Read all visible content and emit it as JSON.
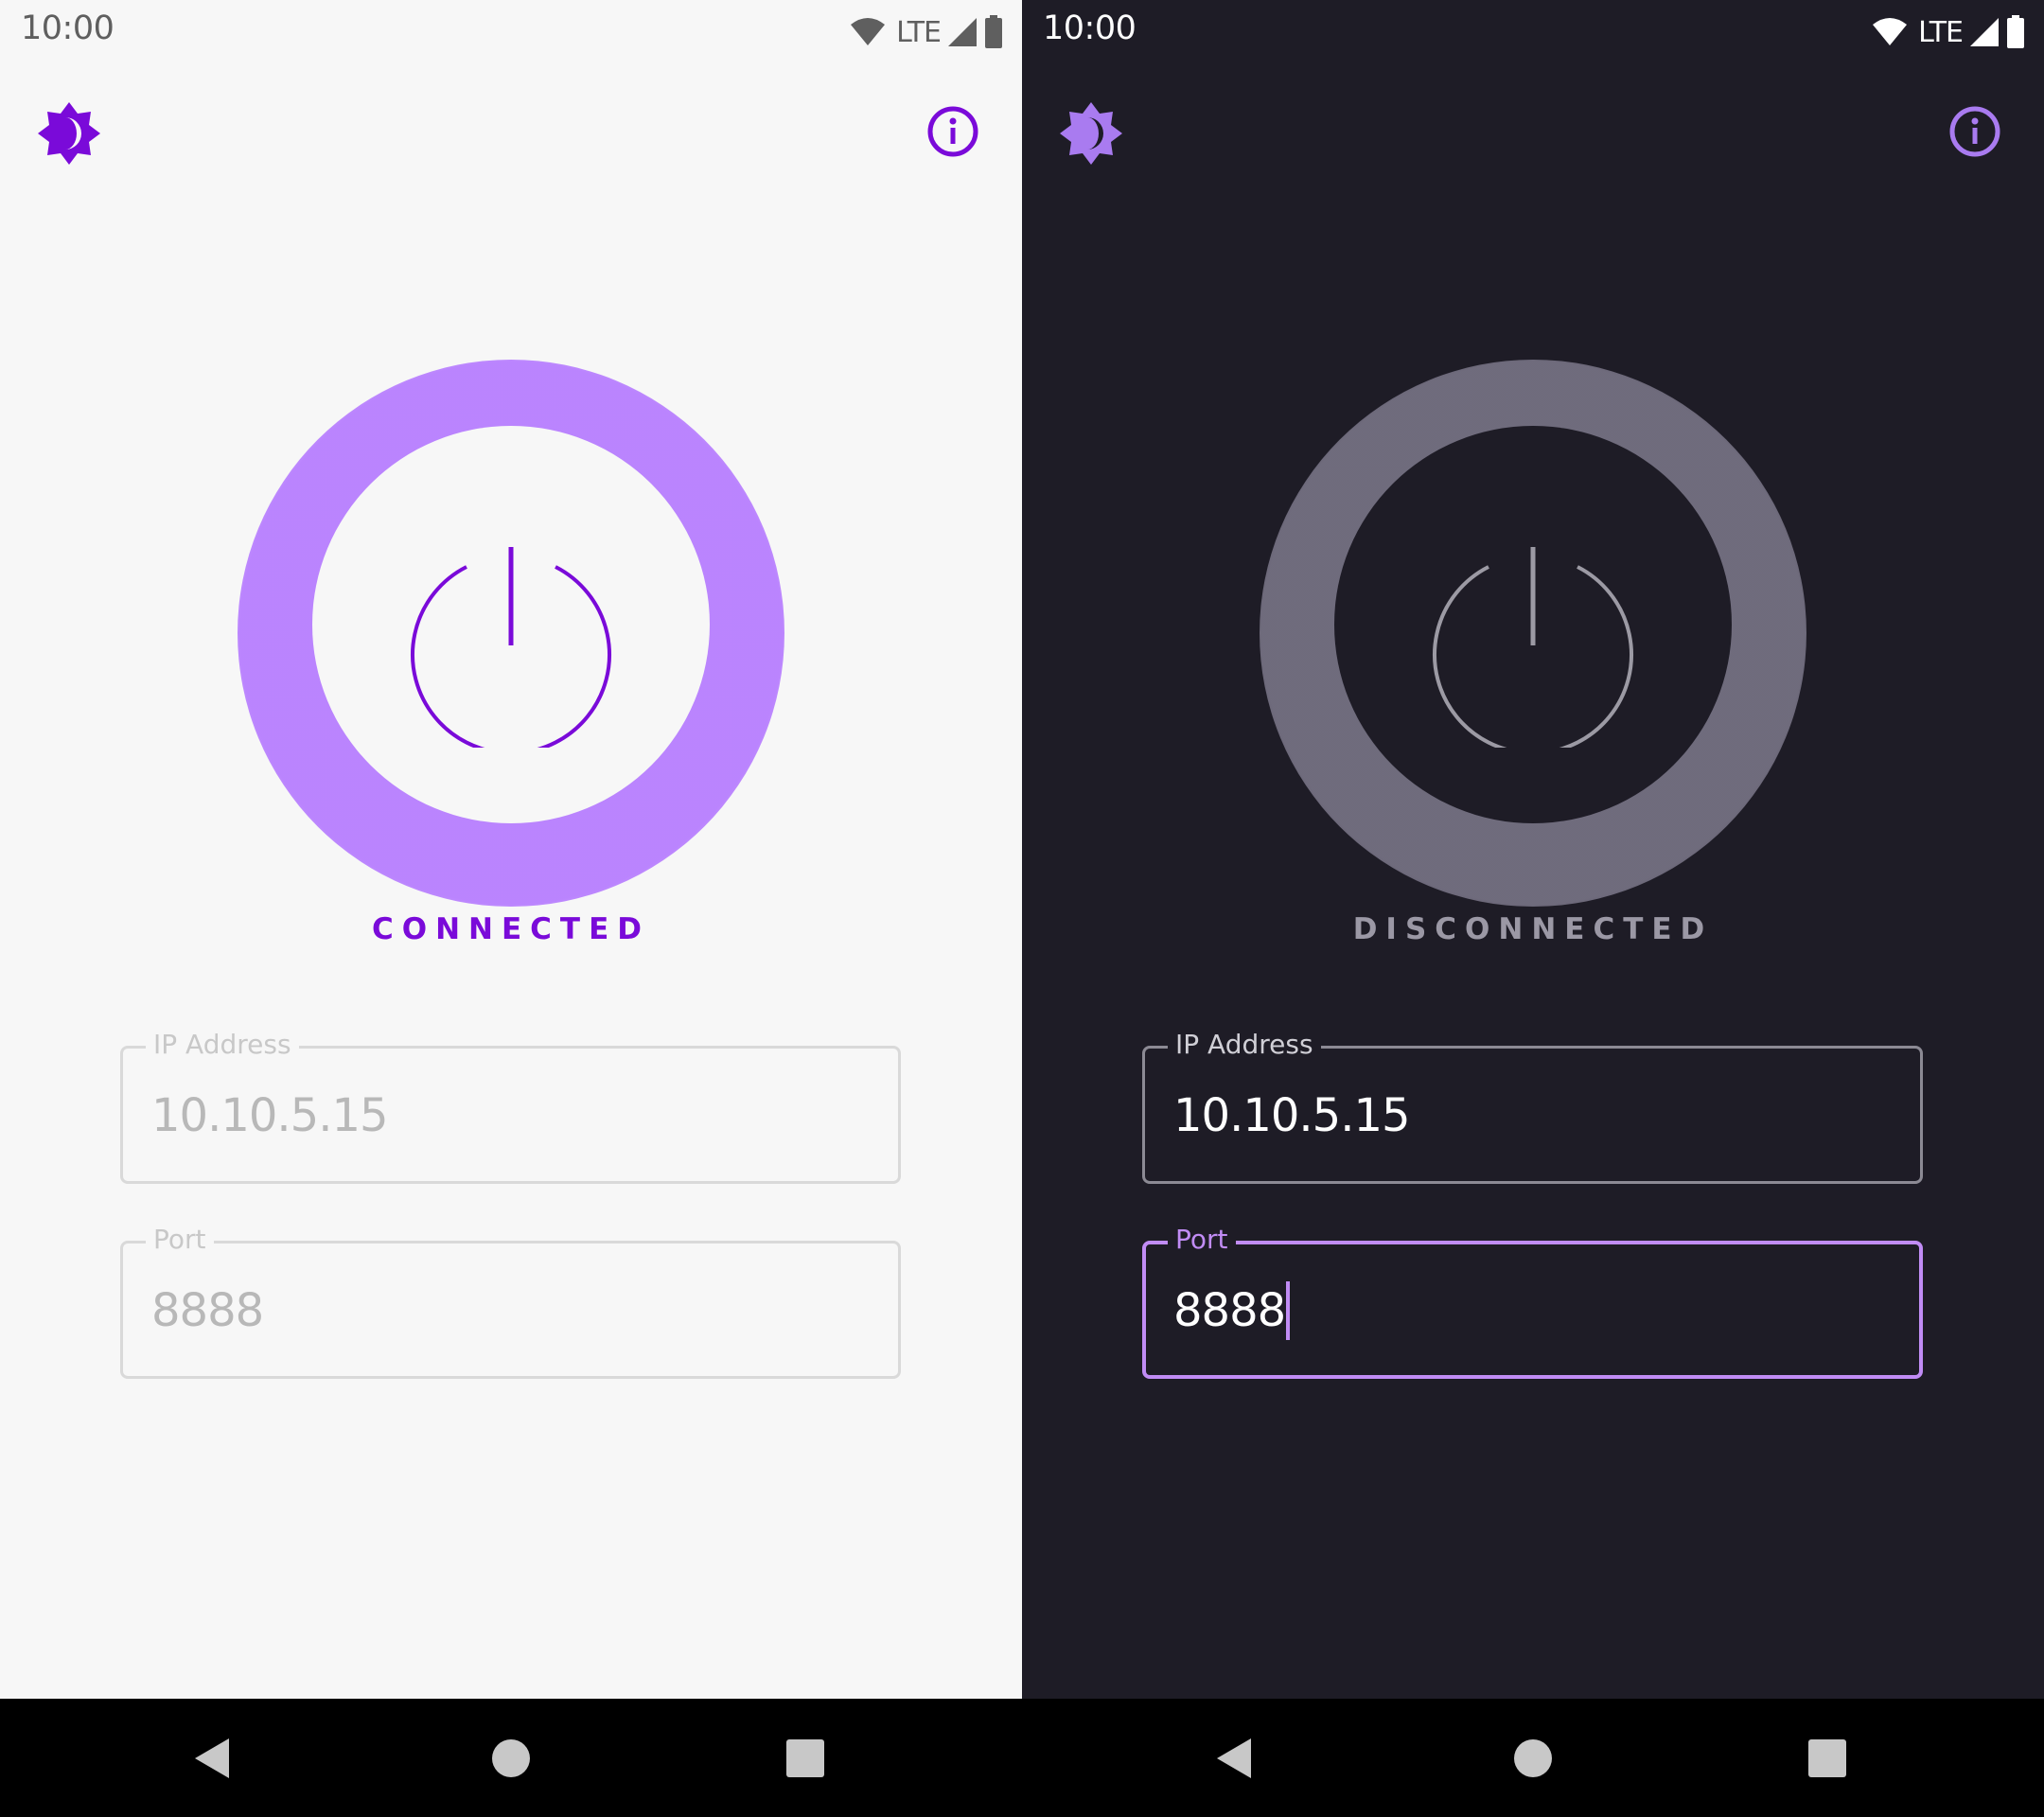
{
  "light": {
    "theme": "light",
    "status_bar": {
      "time": "10:00",
      "network": "LTE"
    },
    "connection_status": "CONNECTED",
    "ip_field": {
      "label": "IP Address",
      "value": "10.10.5.15"
    },
    "port_field": {
      "label": "Port",
      "value": "8888"
    }
  },
  "dark": {
    "theme": "dark",
    "status_bar": {
      "time": "10:00",
      "network": "LTE"
    },
    "connection_status": "DISCONNECTED",
    "ip_field": {
      "label": "IP Address",
      "value": "10.10.5.15"
    },
    "port_field": {
      "label": "Port",
      "value": "8888",
      "focused": true
    }
  },
  "icons": {
    "theme_toggle": "brightness-auto-icon",
    "info": "info-icon",
    "power": "power-icon",
    "wifi": "wifi-icon",
    "cell": "cell-signal-icon",
    "battery": "battery-icon",
    "back": "back-icon",
    "home": "home-icon",
    "recents": "recents-icon"
  },
  "colors": {
    "accent_light": "#7a0ad9",
    "accent_dark": "#a97bf0",
    "focus_dark": "#c18cf5",
    "bg_light": "#f7f7f7",
    "bg_dark": "#1e1c26"
  }
}
